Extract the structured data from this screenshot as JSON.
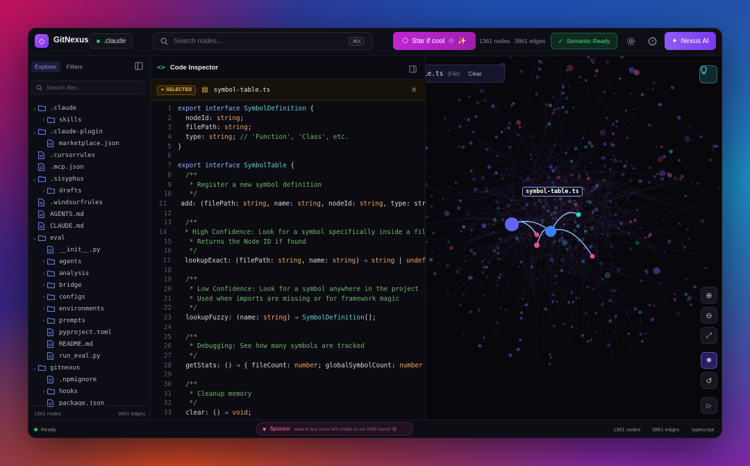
{
  "app": {
    "name": "GitNexus",
    "project": ".claude"
  },
  "search": {
    "placeholder": "Search nodes...",
    "shortcut": "⌘K"
  },
  "header": {
    "star_label": "Star if cool",
    "nodes": "1361 nodes",
    "edges": "3861 edges",
    "semantic": "Semantic Ready",
    "nexus_ai": "Nexus AI"
  },
  "explorer": {
    "tabs": [
      "Explorer",
      "Filters"
    ],
    "search_placeholder": "Search files...",
    "tree": [
      {
        "name": ".claude",
        "type": "folder",
        "open": true,
        "depth": 0
      },
      {
        "name": "skills",
        "type": "folder",
        "open": false,
        "depth": 1
      },
      {
        "name": ".claude-plugin",
        "type": "folder",
        "open": true,
        "depth": 0
      },
      {
        "name": "marketplace.json",
        "type": "file",
        "depth": 1
      },
      {
        "name": ".cursorrules",
        "type": "file",
        "depth": 0
      },
      {
        "name": ".mcp.json",
        "type": "file",
        "depth": 0
      },
      {
        "name": ".sisyphus",
        "type": "folder",
        "open": true,
        "depth": 0
      },
      {
        "name": "drafts",
        "type": "folder",
        "open": false,
        "depth": 1
      },
      {
        "name": ".windsurfrules",
        "type": "file",
        "depth": 0
      },
      {
        "name": "AGENTS.md",
        "type": "file",
        "depth": 0
      },
      {
        "name": "CLAUDE.md",
        "type": "file",
        "depth": 0
      },
      {
        "name": "eval",
        "type": "folder",
        "open": true,
        "depth": 0
      },
      {
        "name": "__init__.py",
        "type": "file",
        "depth": 1
      },
      {
        "name": "agents",
        "type": "folder",
        "open": false,
        "depth": 1
      },
      {
        "name": "analysis",
        "type": "folder",
        "open": false,
        "depth": 1
      },
      {
        "name": "bridge",
        "type": "folder",
        "open": false,
        "depth": 1
      },
      {
        "name": "configs",
        "type": "folder",
        "open": false,
        "depth": 1
      },
      {
        "name": "environments",
        "type": "folder",
        "open": false,
        "depth": 1
      },
      {
        "name": "prompts",
        "type": "folder",
        "open": false,
        "depth": 1
      },
      {
        "name": "pyproject.toml",
        "type": "file",
        "depth": 1
      },
      {
        "name": "README.md",
        "type": "file",
        "depth": 1
      },
      {
        "name": "run_eval.py",
        "type": "file",
        "depth": 1
      },
      {
        "name": "gitnexus",
        "type": "folder",
        "open": true,
        "depth": 0
      },
      {
        "name": ".npmignore",
        "type": "file",
        "depth": 1
      },
      {
        "name": "hooks",
        "type": "folder",
        "open": false,
        "depth": 1
      },
      {
        "name": "package.json",
        "type": "file",
        "depth": 1
      }
    ],
    "footer_nodes": "1361 nodes",
    "footer_edges": "3861 edges"
  },
  "inspector": {
    "title": "Code Inspector",
    "selected_badge": "SELECTED",
    "selected_file": "symbol-table.ts",
    "code_lines": [
      "export interface SymbolDefinition {",
      "  nodeId: string;",
      "  filePath: string;",
      "  type: string; // 'Function', 'Class', etc.",
      "}",
      "",
      "export interface SymbolTable {",
      "  /**",
      "   * Register a new symbol definition",
      "   */",
      "  add: (filePath: string, name: string, nodeId: string, type: str",
      "",
      "  /**",
      "   * High Confidence: Look for a symbol specifically inside a fil",
      "   * Returns the Node ID if found",
      "   */",
      "  lookupExact: (filePath: string, name: string) ⇒ string | undef",
      "",
      "  /**",
      "   * Low Confidence: Look for a symbol anywhere in the project",
      "   * Used when imports are missing or for framework magic",
      "   */",
      "  lookupFuzzy: (name: string) ⇒ SymbolDefinition[];",
      "",
      "  /**",
      "   * Debugging: See how many symbols are tracked",
      "   */",
      "  getStats: () ⇒ { fileCount: number; globalSymbolCount: number",
      "",
      "  /**",
      "   * Cleanup memory",
      "   */",
      "  clear: () ⇒ void;"
    ]
  },
  "graph": {
    "filter_file": "ble.ts",
    "filter_tag": "(File)",
    "clear_label": "Clear",
    "node_label": "symbol-table.ts"
  },
  "statusbar": {
    "status": "Ready",
    "sponsor_label": "Sponsor",
    "sponsor_message": "need to buy some API credits to run SWE-bench 😅",
    "nodes": "1361 nodes",
    "edges": "3861 edges",
    "language": "typescript"
  },
  "colors": {
    "accent": "#8b5cf6",
    "star": "#c026d3",
    "ready": "#22c55e",
    "selected": "#f5b94a"
  }
}
